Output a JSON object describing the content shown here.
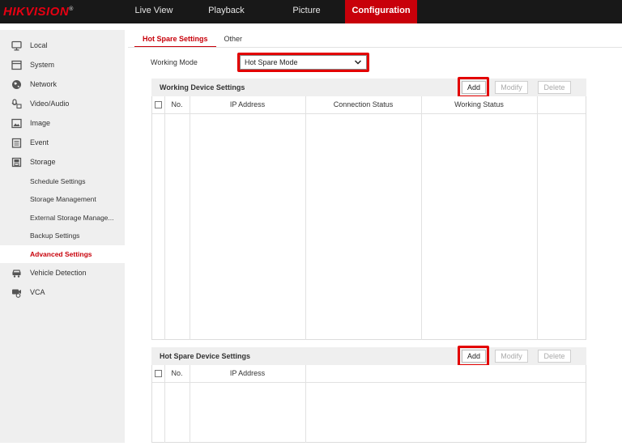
{
  "brand": {
    "logo_text": "HIKVISION",
    "registered_mark": "®",
    "accent_color": "#c8000a"
  },
  "topnav": {
    "items": [
      {
        "label": "Live View",
        "active": false
      },
      {
        "label": "Playback",
        "active": false
      },
      {
        "label": "Picture",
        "active": false
      },
      {
        "label": "Configuration",
        "active": true
      }
    ]
  },
  "sidebar": {
    "items": [
      {
        "label": "Local",
        "icon": "monitor-icon"
      },
      {
        "label": "System",
        "icon": "system-window-icon"
      },
      {
        "label": "Network",
        "icon": "globe-icon"
      },
      {
        "label": "Video/Audio",
        "icon": "video-audio-icon"
      },
      {
        "label": "Image",
        "icon": "image-icon"
      },
      {
        "label": "Event",
        "icon": "event-calendar-icon"
      },
      {
        "label": "Storage",
        "icon": "storage-disk-icon"
      }
    ],
    "storage_sub": [
      {
        "label": "Schedule Settings",
        "active": false
      },
      {
        "label": "Storage Management",
        "active": false
      },
      {
        "label": "External Storage Manage...",
        "active": false
      },
      {
        "label": "Backup Settings",
        "active": false
      },
      {
        "label": "Advanced Settings",
        "active": true
      }
    ],
    "bottom_items": [
      {
        "label": "Vehicle Detection",
        "icon": "vehicle-camera-icon"
      },
      {
        "label": "VCA",
        "icon": "vca-camera-icon"
      }
    ]
  },
  "tabs": [
    {
      "label": "Hot Spare Settings",
      "active": true
    },
    {
      "label": "Other",
      "active": false
    }
  ],
  "working_mode": {
    "label": "Working Mode",
    "value": "Hot Spare Mode"
  },
  "working_devices": {
    "title": "Working Device Settings",
    "buttons": {
      "add": "Add",
      "modify": "Modify",
      "delete": "Delete"
    },
    "columns": [
      "No.",
      "IP Address",
      "Connection Status",
      "Working Status"
    ],
    "rows": []
  },
  "hot_spare_devices": {
    "title": "Hot Spare Device Settings",
    "buttons": {
      "add": "Add",
      "modify": "Modify",
      "delete": "Delete"
    },
    "columns": [
      "No.",
      "IP Address"
    ],
    "rows": []
  }
}
